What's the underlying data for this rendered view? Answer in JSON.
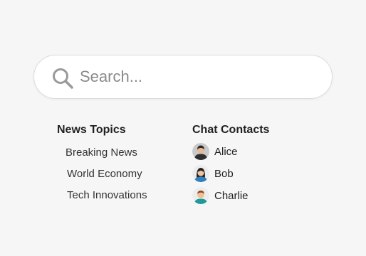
{
  "search": {
    "placeholder": "Search...",
    "value": "",
    "icon": "search-icon"
  },
  "news_topics": {
    "title": "News Topics",
    "items": [
      {
        "label": "Breaking News"
      },
      {
        "label": "World Economy"
      },
      {
        "label": "Tech Innovations"
      }
    ]
  },
  "chat_contacts": {
    "title": "Chat Contacts",
    "items": [
      {
        "name": "Alice",
        "avatar": "avatar-dark-hair-icon"
      },
      {
        "name": "Bob",
        "avatar": "avatar-long-hair-icon"
      },
      {
        "name": "Charlie",
        "avatar": "avatar-teal-shirt-icon"
      }
    ]
  },
  "colors": {
    "background": "#f6f6f6",
    "search_border": "#dcdcdc",
    "placeholder": "#8a8a8a",
    "text": "#222222"
  }
}
